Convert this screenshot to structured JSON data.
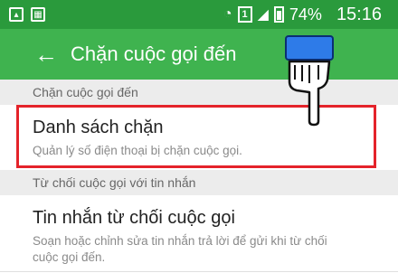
{
  "status_bar": {
    "left_icons": [
      "image-icon",
      "calendar-icon"
    ],
    "sim_label": "1",
    "battery": "74%",
    "time": "15:16"
  },
  "app_bar": {
    "title": "Chặn cuộc gọi đến"
  },
  "sections": [
    {
      "header": "Chặn cuộc gọi đến",
      "items": [
        {
          "title": "Danh sách chặn",
          "subtitle": "Quản lý số điện thoại bị chặn cuộc gọi."
        }
      ]
    },
    {
      "header": "Từ chối cuộc gọi với tin nhắn",
      "items": [
        {
          "title": "Tin nhắn từ chối cuộc gọi",
          "subtitle": "Soạn hoặc chỉnh sửa tin nhắn trả lời để gửi khi từ chối cuộc gọi đến."
        }
      ]
    }
  ],
  "colors": {
    "status_bar": "#2a9a3c",
    "app_bar": "#3fb34f",
    "highlight": "#e4232a",
    "hand_cuff": "#2e7be8"
  }
}
